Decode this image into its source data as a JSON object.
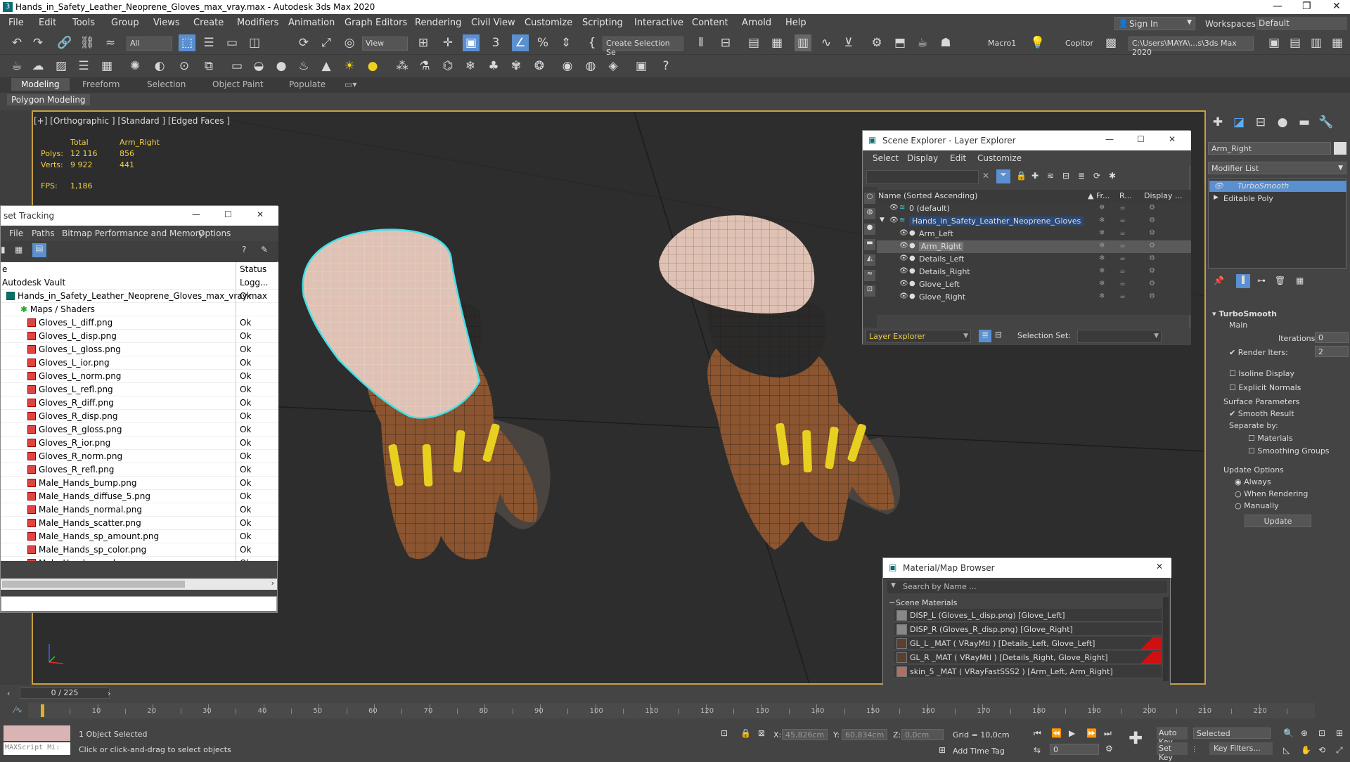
{
  "window": {
    "title": "Hands_in_Safety_Leather_Neoprene_Gloves_max_vray.max - Autodesk 3ds Max 2020",
    "controls": [
      "—",
      "❐",
      "✕"
    ]
  },
  "menu": {
    "items": [
      "File",
      "Edit",
      "Tools",
      "Group",
      "Views",
      "Create",
      "Modifiers",
      "Animation",
      "Graph Editors",
      "Rendering",
      "Civil View",
      "Customize",
      "Scripting",
      "Interactive",
      "Content",
      "Arnold",
      "Help"
    ],
    "sign_in": "Sign In",
    "workspaces_label": "Workspaces:",
    "workspace_value": "Default"
  },
  "toolbar": {
    "selection_filter": "All",
    "view_dropdown": "View",
    "create_selection_set": "Create Selection Se",
    "macro": "Macro1",
    "copitor": "Copitor",
    "path": "C:\\Users\\MAYA\\...s\\3ds Max 2020"
  },
  "ribbon": {
    "tabs": [
      "Modeling",
      "Freeform",
      "Selection",
      "Object Paint",
      "Populate"
    ],
    "active_tab": "Modeling",
    "sub_label": "Polygon Modeling"
  },
  "viewport": {
    "label": "[+] [Orthographic ] [Standard ] [Edged Faces ]",
    "stats": {
      "total_label": "Total",
      "object_label": "Arm_Right",
      "polys_label": "Polys:",
      "polys_total": "12 116",
      "polys_obj": "856",
      "verts_label": "Verts:",
      "verts_total": "9 922",
      "verts_obj": "441",
      "fps_label": "FPS:",
      "fps": "1,186"
    }
  },
  "asset_tracking": {
    "title": "set Tracking",
    "menu": [
      "File",
      "Paths",
      "Bitmap Performance and Memory",
      "Options"
    ],
    "col_name": "e",
    "col_status": "Status",
    "rows": [
      {
        "name": "Autodesk Vault",
        "status": "Logg...",
        "indent": 0
      },
      {
        "name": "Hands_in_Safety_Leather_Neoprene_Gloves_max_vray.max",
        "status": "Ok",
        "indent": 1
      },
      {
        "name": "Maps / Shaders",
        "status": "",
        "indent": 2
      },
      {
        "name": "Gloves_L_diff.png",
        "status": "Ok",
        "indent": 3
      },
      {
        "name": "Gloves_L_disp.png",
        "status": "Ok",
        "indent": 3
      },
      {
        "name": "Gloves_L_gloss.png",
        "status": "Ok",
        "indent": 3
      },
      {
        "name": "Gloves_L_ior.png",
        "status": "Ok",
        "indent": 3
      },
      {
        "name": "Gloves_L_norm.png",
        "status": "Ok",
        "indent": 3
      },
      {
        "name": "Gloves_L_refl.png",
        "status": "Ok",
        "indent": 3
      },
      {
        "name": "Gloves_R_diff.png",
        "status": "Ok",
        "indent": 3
      },
      {
        "name": "Gloves_R_disp.png",
        "status": "Ok",
        "indent": 3
      },
      {
        "name": "Gloves_R_gloss.png",
        "status": "Ok",
        "indent": 3
      },
      {
        "name": "Gloves_R_ior.png",
        "status": "Ok",
        "indent": 3
      },
      {
        "name": "Gloves_R_norm.png",
        "status": "Ok",
        "indent": 3
      },
      {
        "name": "Gloves_R_refl.png",
        "status": "Ok",
        "indent": 3
      },
      {
        "name": "Male_Hands_bump.png",
        "status": "Ok",
        "indent": 3
      },
      {
        "name": "Male_Hands_diffuse_5.png",
        "status": "Ok",
        "indent": 3
      },
      {
        "name": "Male_Hands_normal.png",
        "status": "Ok",
        "indent": 3
      },
      {
        "name": "Male_Hands_scatter.png",
        "status": "Ok",
        "indent": 3
      },
      {
        "name": "Male_Hands_sp_amount.png",
        "status": "Ok",
        "indent": 3
      },
      {
        "name": "Male_Hands_sp_color.png",
        "status": "Ok",
        "indent": 3
      },
      {
        "name": "Male_Hands_sp_gloss.png",
        "status": "Ok",
        "indent": 3
      }
    ]
  },
  "scene_explorer": {
    "title": "Scene Explorer - Layer Explorer",
    "menu": [
      "Select",
      "Display",
      "Edit",
      "Customize"
    ],
    "col_name": "Name (Sorted Ascending)",
    "col_fr": "Fr...",
    "col_r": "R...",
    "col_display": "Display ...",
    "rows": [
      {
        "name": "0 (default)",
        "indent": 1,
        "state": "normal"
      },
      {
        "name": "Hands_in_Safety_Leather_Neoprene_Gloves",
        "indent": 1,
        "state": "layer"
      },
      {
        "name": "Arm_Left",
        "indent": 2,
        "state": "normal"
      },
      {
        "name": "Arm_Right",
        "indent": 2,
        "state": "selected"
      },
      {
        "name": "Details_Left",
        "indent": 2,
        "state": "normal"
      },
      {
        "name": "Details_Right",
        "indent": 2,
        "state": "normal"
      },
      {
        "name": "Glove_Left",
        "indent": 2,
        "state": "normal"
      },
      {
        "name": "Glove_Right",
        "indent": 2,
        "state": "normal"
      }
    ],
    "footer_label": "Layer Explorer",
    "selection_set_label": "Selection Set:"
  },
  "material_browser": {
    "title": "Material/Map Browser",
    "search_placeholder": "Search by Name ...",
    "group": "Scene Materials",
    "rows": [
      {
        "name": "DISP_L (Gloves_L_disp.png) [Glove_Left]",
        "swatch": "#888888",
        "red": false
      },
      {
        "name": "DISP_R (Gloves_R_disp.png) [Glove_Right]",
        "swatch": "#888888",
        "red": false
      },
      {
        "name": "GL_L _MAT  ( VRayMtl ) [Details_Left, Glove_Left]",
        "swatch": "#5a4030",
        "red": true
      },
      {
        "name": "GL_R _MAT  ( VRayMtl ) [Details_Right, Glove_Right]",
        "swatch": "#5a4030",
        "red": true
      },
      {
        "name": "skin_5 _MAT  ( VRayFastSSS2 ) [Arm_Left, Arm_Right]",
        "swatch": "#b07060",
        "red": false
      }
    ]
  },
  "command_panel": {
    "object_name": "Arm_Right",
    "modifier_list": "Modifier List",
    "stack": [
      "TurboSmooth",
      "Editable Poly"
    ],
    "turbosmooth": {
      "title": "TurboSmooth",
      "main": "Main",
      "iterations_label": "Iterations:",
      "iterations": "0",
      "render_iters_label": "Render Iters:",
      "render_iters": "2",
      "isoline": "Isoline Display",
      "explicit": "Explicit Normals",
      "surface_params": "Surface Parameters",
      "smooth_result": "Smooth Result",
      "separate_by": "Separate by:",
      "materials": "Materials",
      "smoothing_groups": "Smoothing Groups",
      "update_options": "Update Options",
      "always": "Always",
      "when_rendering": "When Rendering",
      "manually": "Manually",
      "update": "Update"
    }
  },
  "timeline": {
    "frame": "0 / 225",
    "ticks": [
      "10",
      "20",
      "30",
      "40",
      "50",
      "60",
      "70",
      "80",
      "90",
      "100",
      "110",
      "120",
      "130",
      "140",
      "150",
      "160",
      "170",
      "180",
      "190",
      "200",
      "210",
      "220"
    ]
  },
  "status": {
    "maxscript": "MAXScript Mi:",
    "selected": "1 Object Selected",
    "prompt": "Click or click-and-drag to select objects",
    "x_label": "X:",
    "x": "45,826cm",
    "y_label": "Y:",
    "y": "60,834cm",
    "z_label": "Z:",
    "z": "0,0cm",
    "grid": "Grid = 10,0cm",
    "add_time_tag": "Add Time Tag",
    "auto_key": "Auto Key",
    "set_key": "Set Key",
    "selected_dd": "Selected",
    "key_filters": "Key Filters...",
    "frame_spin": "0"
  }
}
